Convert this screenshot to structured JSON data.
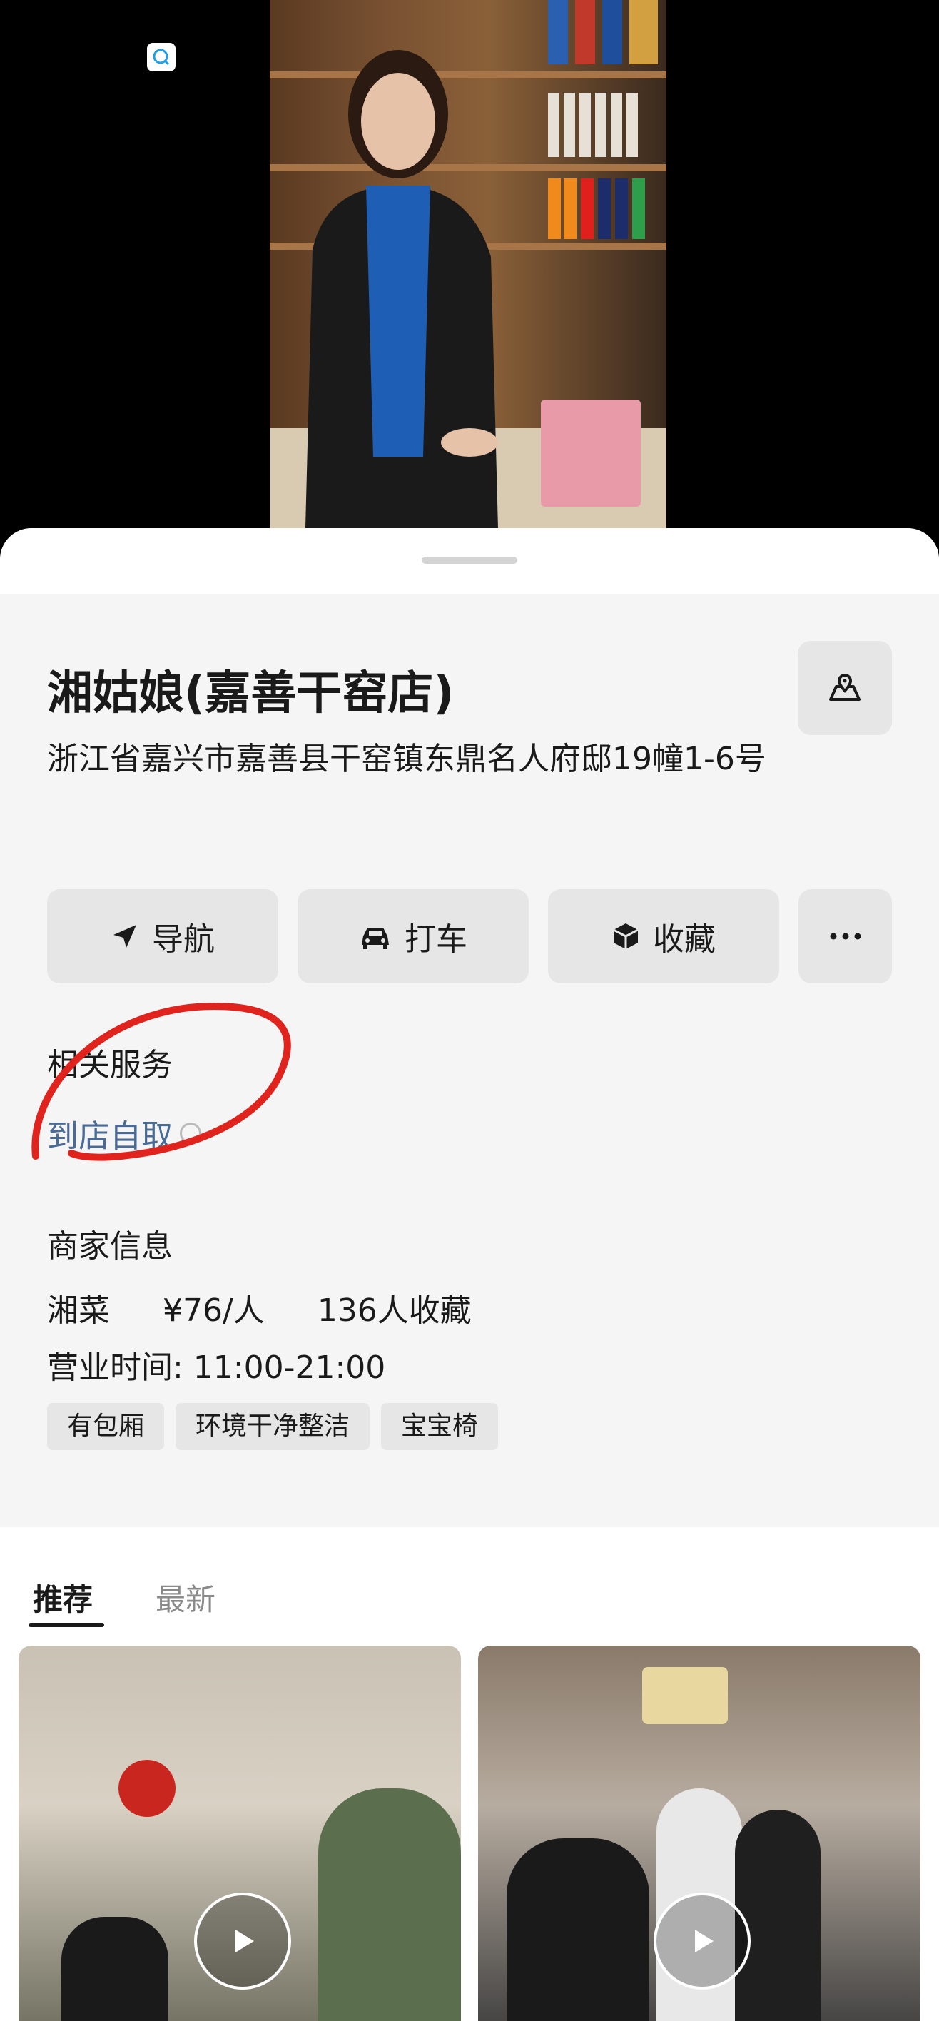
{
  "store": {
    "name": "湘姑娘(嘉善干窑店)",
    "address": "浙江省嘉兴市嘉善县干窑镇东鼎名人府邸19幢1-6号"
  },
  "actions": [
    {
      "label": "导航",
      "icon": "navigation-arrow-icon"
    },
    {
      "label": "打车",
      "icon": "car-icon"
    },
    {
      "label": "收藏",
      "icon": "box-icon"
    },
    {
      "label": "",
      "icon": "more-icon"
    }
  ],
  "related_services": {
    "heading": "相关服务",
    "items": [
      {
        "label": "到店自取",
        "icon": "mini-program-icon"
      }
    ]
  },
  "merchant": {
    "heading": "商家信息",
    "cuisine": "湘菜",
    "price": "¥76/人",
    "favorites": "136人收藏",
    "hours": "营业时间: 11:00-21:00",
    "tags": [
      "有包厢",
      "环境干净整洁",
      "宝宝椅"
    ]
  },
  "feed": {
    "tabs": [
      "推荐",
      "最新"
    ],
    "active_tab": 0
  },
  "colors": {
    "accent_link": "#4a6b96",
    "annotation_red": "#e0231d",
    "sheet_bg": "#f5f5f5",
    "button_bg": "#e6e6e6"
  }
}
